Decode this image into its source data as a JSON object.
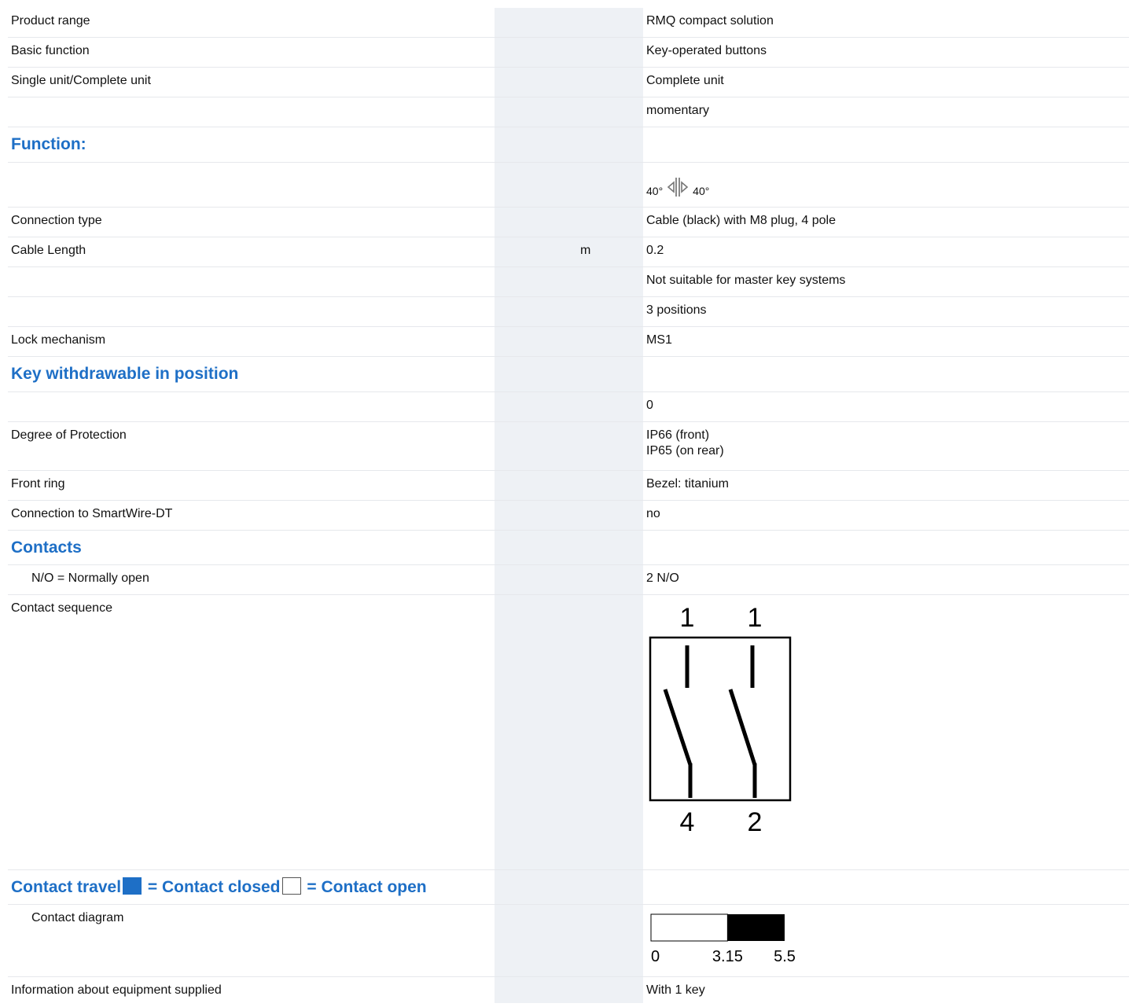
{
  "rows": [
    {
      "label": "Product range",
      "unit": "",
      "value": "RMQ compact solution"
    },
    {
      "label": "Basic function",
      "unit": "",
      "value": "Key-operated buttons"
    },
    {
      "label": "Single unit/Complete unit",
      "unit": "",
      "value": "Complete unit"
    },
    {
      "label": "",
      "unit": "",
      "value": "momentary"
    }
  ],
  "function_heading": "Function:",
  "function_value": {
    "left": "40°",
    "right": "40°",
    "icon": "key-switch-rotation-icon"
  },
  "rows2": [
    {
      "label": "Connection type",
      "unit": "",
      "value": "Cable (black) with M8 plug, 4 pole"
    },
    {
      "label": "Cable Length",
      "unit": "m",
      "value": "0.2"
    },
    {
      "label": "",
      "unit": "",
      "value": "Not suitable for master key systems"
    },
    {
      "label": "",
      "unit": "",
      "value": "3 positions"
    },
    {
      "label": "Lock mechanism",
      "unit": "",
      "value": "MS1"
    }
  ],
  "key_heading": "Key withdrawable in position",
  "rows3": [
    {
      "label": "",
      "unit": "",
      "value": "0"
    },
    {
      "label": "Degree of Protection",
      "unit": "",
      "value": "IP66 (front)\nIP65 (on rear)"
    },
    {
      "label": "Front ring",
      "unit": "",
      "value": "Bezel: titanium"
    },
    {
      "label": "Connection to SmartWire-DT",
      "unit": "",
      "value": "no"
    }
  ],
  "contacts_heading": "Contacts",
  "rows4": [
    {
      "label": "N/O = Normally open",
      "unit": "",
      "value": "2 N/O"
    }
  ],
  "contact_sequence": {
    "label": "Contact sequence",
    "top_labels": [
      "1",
      "1"
    ],
    "bottom_labels": [
      "4",
      "2"
    ]
  },
  "travel_heading": {
    "part1": "Contact travel",
    "part2": " = Contact closed",
    "part3": " = Contact open"
  },
  "contact_diagram": {
    "label": "Contact diagram",
    "ticks": [
      "0",
      "3.15",
      "5.5"
    ],
    "open_from": 0,
    "closed_from": 3.15,
    "end": 5.5
  },
  "rows5": [
    {
      "label": "Information about equipment supplied",
      "unit": "",
      "value": "With 1 key"
    }
  ],
  "colors": {
    "heading": "#1e6fc6",
    "stripe": "#eef1f5",
    "divider": "#e6e8ec"
  }
}
